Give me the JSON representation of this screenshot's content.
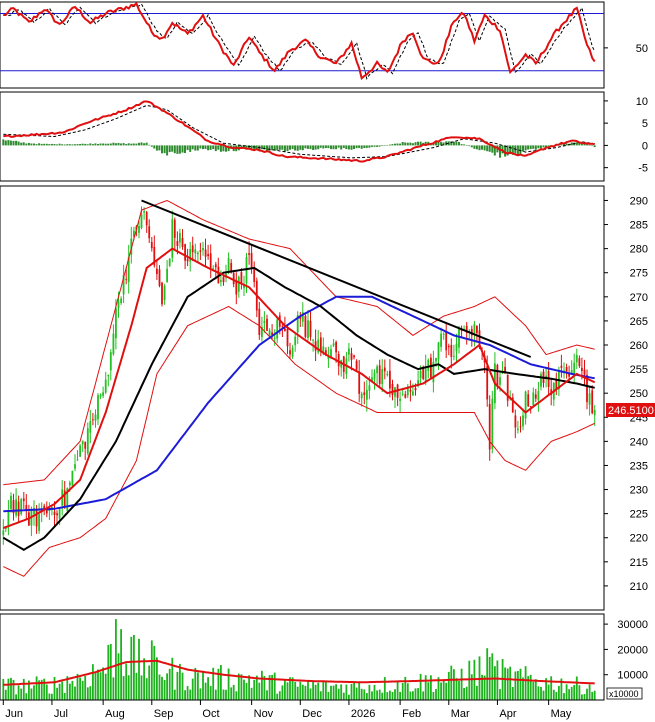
{
  "chart_data": {
    "type": "candlestick",
    "ticker": "",
    "last_price_label": "246.5100",
    "x_axis": {
      "month_labels": [
        "Jun",
        "Jul",
        "Aug",
        "Sep",
        "Oct",
        "Nov",
        "Dec",
        "2026",
        "Feb",
        "Mar",
        "Apr",
        "May"
      ],
      "n_sessions": 232
    },
    "colors": {
      "up": "#22c022",
      "down": "#e01010",
      "ma_fast": "#e01010",
      "ma_mid": "#000000",
      "ma_slow": "#1c1cd6",
      "bollinger": "#e01010",
      "trendline": "#000000",
      "rsi": "#e01010",
      "rsi_levels": "#1c1cd6",
      "macd": "#e01010",
      "hist": "#2e8b2e",
      "volume": "#1db31d",
      "volume_ma": "#e01010",
      "price_tag_bg": "#e01010"
    },
    "panels": [
      {
        "name": "rsi",
        "yticks": [
          50
        ],
        "ylim": [
          15,
          90
        ],
        "levels": [
          30,
          80
        ],
        "anchors": [
          [
            0,
            78
          ],
          [
            4,
            84
          ],
          [
            10,
            72
          ],
          [
            16,
            84
          ],
          [
            22,
            70
          ],
          [
            28,
            86
          ],
          [
            34,
            72
          ],
          [
            40,
            80
          ],
          [
            46,
            84
          ],
          [
            52,
            88
          ],
          [
            58,
            64
          ],
          [
            62,
            58
          ],
          [
            66,
            72
          ],
          [
            72,
            62
          ],
          [
            78,
            78
          ],
          [
            84,
            54
          ],
          [
            90,
            34
          ],
          [
            96,
            60
          ],
          [
            100,
            46
          ],
          [
            106,
            30
          ],
          [
            112,
            48
          ],
          [
            118,
            56
          ],
          [
            124,
            42
          ],
          [
            130,
            36
          ],
          [
            136,
            54
          ],
          [
            140,
            24
          ],
          [
            146,
            36
          ],
          [
            150,
            28
          ],
          [
            156,
            56
          ],
          [
            160,
            64
          ],
          [
            164,
            40
          ],
          [
            170,
            36
          ],
          [
            176,
            74
          ],
          [
            180,
            80
          ],
          [
            184,
            56
          ],
          [
            188,
            78
          ],
          [
            194,
            66
          ],
          [
            198,
            28
          ],
          [
            204,
            44
          ],
          [
            208,
            36
          ],
          [
            214,
            58
          ],
          [
            218,
            70
          ],
          [
            224,
            84
          ],
          [
            228,
            52
          ],
          [
            232,
            32
          ]
        ]
      },
      {
        "name": "macd",
        "yticks": [
          10,
          5,
          0,
          -5
        ],
        "ylim": [
          -8,
          12
        ],
        "line_anchors": [
          [
            0,
            2
          ],
          [
            14,
            2.5
          ],
          [
            24,
            3
          ],
          [
            32,
            5
          ],
          [
            40,
            6.5
          ],
          [
            48,
            8
          ],
          [
            56,
            10
          ],
          [
            62,
            8
          ],
          [
            70,
            5
          ],
          [
            80,
            1
          ],
          [
            90,
            -0.5
          ],
          [
            100,
            -1
          ],
          [
            110,
            -2.5
          ],
          [
            126,
            -3
          ],
          [
            140,
            -3.5
          ],
          [
            150,
            -2.5
          ],
          [
            164,
            0
          ],
          [
            176,
            2
          ],
          [
            186,
            1.5
          ],
          [
            196,
            -1.5
          ],
          [
            204,
            -2.5
          ],
          [
            212,
            -0.5
          ],
          [
            222,
            1
          ],
          [
            232,
            0
          ]
        ],
        "signal_anchors": [
          [
            0,
            2.5
          ],
          [
            20,
            2
          ],
          [
            32,
            3.5
          ],
          [
            44,
            6
          ],
          [
            56,
            9
          ],
          [
            64,
            8
          ],
          [
            74,
            4
          ],
          [
            86,
            0.5
          ],
          [
            100,
            -0.5
          ],
          [
            116,
            -2
          ],
          [
            136,
            -2.8
          ],
          [
            150,
            -2.5
          ],
          [
            168,
            -0.5
          ],
          [
            180,
            1.5
          ],
          [
            192,
            0.5
          ],
          [
            204,
            -1.5
          ],
          [
            216,
            -0.5
          ],
          [
            226,
            0.8
          ],
          [
            232,
            0.3
          ]
        ],
        "hist_anchors": [
          [
            0,
            1.2
          ],
          [
            8,
            0.6
          ],
          [
            16,
            0.3
          ],
          [
            30,
            0.3
          ],
          [
            40,
            0.5
          ],
          [
            50,
            0.4
          ],
          [
            56,
            0.6
          ],
          [
            62,
            -2
          ],
          [
            70,
            -1.5
          ],
          [
            78,
            -0.8
          ],
          [
            86,
            -1.2
          ],
          [
            96,
            -0.8
          ],
          [
            106,
            -1.2
          ],
          [
            116,
            -1
          ],
          [
            126,
            -0.6
          ],
          [
            136,
            -0.8
          ],
          [
            146,
            -0.3
          ],
          [
            156,
            0.6
          ],
          [
            166,
            0.7
          ],
          [
            176,
            1
          ],
          [
            184,
            -0.6
          ],
          [
            194,
            -2.2
          ],
          [
            202,
            -1.6
          ],
          [
            210,
            -0.6
          ],
          [
            220,
            0.5
          ],
          [
            226,
            0.6
          ],
          [
            232,
            -0.5
          ]
        ]
      },
      {
        "name": "price",
        "yticks": [
          290,
          285,
          280,
          275,
          270,
          265,
          260,
          255,
          250,
          245,
          240,
          235,
          230,
          225,
          220,
          215,
          210
        ],
        "ylim": [
          205,
          293
        ],
        "close_anchors": [
          [
            0,
            222
          ],
          [
            3,
            228
          ],
          [
            6,
            226
          ],
          [
            12,
            224
          ],
          [
            18,
            226
          ],
          [
            24,
            228
          ],
          [
            30,
            238
          ],
          [
            36,
            246
          ],
          [
            40,
            252
          ],
          [
            42,
            260
          ],
          [
            46,
            272
          ],
          [
            50,
            280
          ],
          [
            54,
            288
          ],
          [
            58,
            280
          ],
          [
            62,
            268
          ],
          [
            66,
            284
          ],
          [
            72,
            278
          ],
          [
            76,
            280
          ],
          [
            80,
            277
          ],
          [
            84,
            274
          ],
          [
            88,
            276
          ],
          [
            92,
            272
          ],
          [
            96,
            278
          ],
          [
            100,
            264
          ],
          [
            104,
            262
          ],
          [
            108,
            264
          ],
          [
            112,
            260
          ],
          [
            116,
            266
          ],
          [
            120,
            262
          ],
          [
            126,
            260
          ],
          [
            132,
            256
          ],
          [
            136,
            258
          ],
          [
            140,
            250
          ],
          [
            144,
            254
          ],
          [
            150,
            252
          ],
          [
            156,
            248
          ],
          [
            160,
            252
          ],
          [
            164,
            254
          ],
          [
            168,
            256
          ],
          [
            172,
            262
          ],
          [
            176,
            258
          ],
          [
            180,
            264
          ],
          [
            184,
            262
          ],
          [
            188,
            258
          ],
          [
            190,
            240
          ],
          [
            192,
            254
          ],
          [
            196,
            252
          ],
          [
            200,
            242
          ],
          [
            204,
            248
          ],
          [
            210,
            252
          ],
          [
            216,
            252
          ],
          [
            220,
            254
          ],
          [
            224,
            260
          ],
          [
            228,
            250
          ],
          [
            232,
            246.5
          ]
        ],
        "ma_fast_anchors": [
          [
            0,
            222
          ],
          [
            10,
            224
          ],
          [
            20,
            227
          ],
          [
            30,
            232
          ],
          [
            40,
            246
          ],
          [
            50,
            264
          ],
          [
            56,
            276
          ],
          [
            66,
            280
          ],
          [
            80,
            276
          ],
          [
            96,
            272
          ],
          [
            110,
            264
          ],
          [
            126,
            258
          ],
          [
            140,
            254
          ],
          [
            150,
            250
          ],
          [
            164,
            252
          ],
          [
            176,
            256
          ],
          [
            186,
            260
          ],
          [
            192,
            252
          ],
          [
            204,
            246
          ],
          [
            214,
            250
          ],
          [
            224,
            254
          ],
          [
            232,
            252
          ]
        ],
        "ma_mid_anchors": [
          [
            0,
            220
          ],
          [
            8,
            217.5
          ],
          [
            16,
            220
          ],
          [
            30,
            228
          ],
          [
            44,
            240
          ],
          [
            58,
            256
          ],
          [
            72,
            270
          ],
          [
            86,
            275
          ],
          [
            98,
            276
          ],
          [
            110,
            272
          ],
          [
            124,
            268
          ],
          [
            138,
            262
          ],
          [
            150,
            258
          ],
          [
            162,
            255
          ],
          [
            170,
            256
          ],
          [
            176,
            254
          ],
          [
            188,
            255
          ],
          [
            200,
            254
          ],
          [
            214,
            253
          ],
          [
            224,
            252
          ],
          [
            232,
            251
          ]
        ],
        "ma_slow_anchors": [
          [
            0,
            225.5
          ],
          [
            20,
            226
          ],
          [
            40,
            228
          ],
          [
            60,
            234
          ],
          [
            80,
            248
          ],
          [
            100,
            260
          ],
          [
            116,
            266
          ],
          [
            130,
            270
          ],
          [
            144,
            270
          ],
          [
            160,
            266
          ],
          [
            176,
            262
          ],
          [
            190,
            260
          ],
          [
            206,
            256
          ],
          [
            222,
            254
          ],
          [
            232,
            253
          ]
        ],
        "bb_upper_anchors": [
          [
            0,
            231
          ],
          [
            16,
            232
          ],
          [
            30,
            240
          ],
          [
            44,
            268
          ],
          [
            54,
            288
          ],
          [
            64,
            290
          ],
          [
            78,
            286
          ],
          [
            96,
            282
          ],
          [
            112,
            280
          ],
          [
            130,
            270
          ],
          [
            146,
            268
          ],
          [
            160,
            262
          ],
          [
            172,
            266
          ],
          [
            184,
            268
          ],
          [
            192,
            270
          ],
          [
            204,
            264
          ],
          [
            212,
            258
          ],
          [
            224,
            260
          ],
          [
            232,
            259
          ]
        ],
        "bb_lower_anchors": [
          [
            0,
            214
          ],
          [
            8,
            212
          ],
          [
            18,
            218
          ],
          [
            30,
            220
          ],
          [
            40,
            224
          ],
          [
            52,
            236
          ],
          [
            60,
            254
          ],
          [
            72,
            264
          ],
          [
            88,
            268
          ],
          [
            100,
            264
          ],
          [
            114,
            256
          ],
          [
            130,
            250
          ],
          [
            146,
            246
          ],
          [
            160,
            246
          ],
          [
            174,
            246
          ],
          [
            184,
            246
          ],
          [
            190,
            240
          ],
          [
            196,
            236
          ],
          [
            204,
            234
          ],
          [
            214,
            240
          ],
          [
            224,
            242
          ],
          [
            232,
            244
          ]
        ],
        "trendline": [
          [
            54,
            290
          ],
          [
            206,
            257.5
          ]
        ]
      },
      {
        "name": "volume",
        "yticks": [
          30000,
          20000,
          10000
        ],
        "unit_label": "x10000",
        "ylim": [
          0,
          34000
        ],
        "anchors": [
          [
            0,
            6000
          ],
          [
            10,
            6000
          ],
          [
            20,
            6500
          ],
          [
            30,
            9000
          ],
          [
            40,
            14000
          ],
          [
            44,
            22000
          ],
          [
            48,
            19000
          ],
          [
            52,
            16000
          ],
          [
            60,
            15000
          ],
          [
            68,
            10000
          ],
          [
            78,
            9000
          ],
          [
            96,
            9000
          ],
          [
            110,
            6500
          ],
          [
            126,
            5500
          ],
          [
            144,
            6000
          ],
          [
            160,
            7000
          ],
          [
            176,
            9000
          ],
          [
            190,
            14000
          ],
          [
            196,
            10000
          ],
          [
            208,
            8000
          ],
          [
            224,
            6000
          ],
          [
            232,
            5500
          ]
        ],
        "ma_anchors": [
          [
            0,
            6000
          ],
          [
            20,
            7000
          ],
          [
            36,
            11000
          ],
          [
            48,
            15000
          ],
          [
            60,
            15500
          ],
          [
            72,
            12000
          ],
          [
            86,
            10000
          ],
          [
            100,
            8500
          ],
          [
            120,
            7500
          ],
          [
            140,
            7000
          ],
          [
            160,
            7500
          ],
          [
            176,
            8000
          ],
          [
            192,
            8500
          ],
          [
            210,
            7500
          ],
          [
            232,
            6500
          ]
        ]
      }
    ]
  }
}
